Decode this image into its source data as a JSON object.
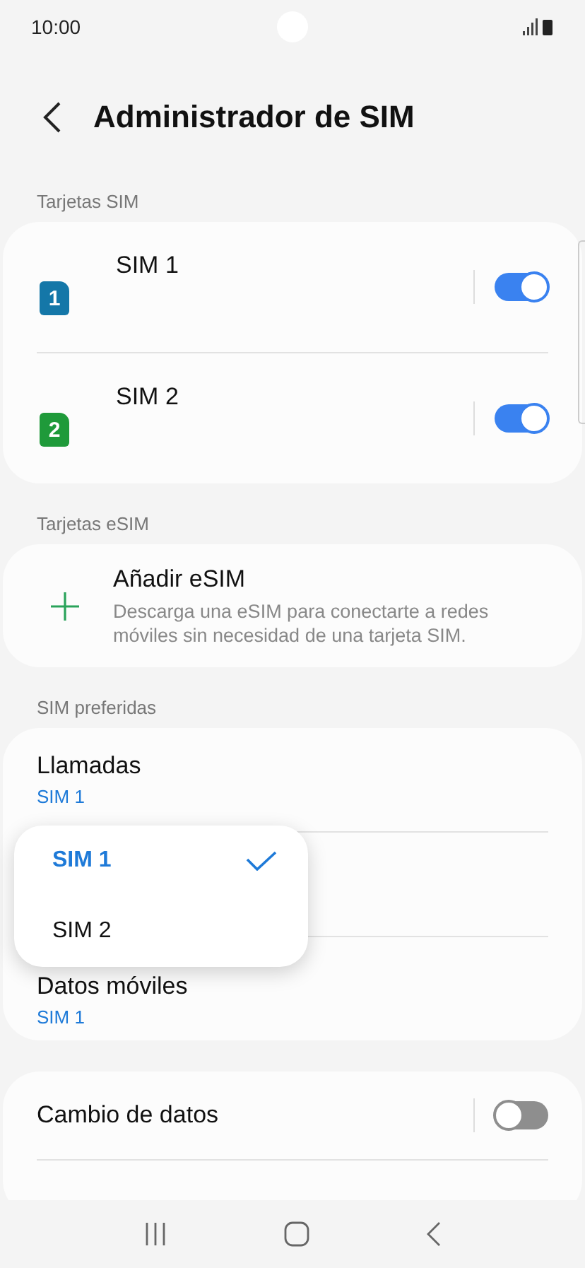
{
  "status_bar": {
    "time": "10:00"
  },
  "header": {
    "title": "Administrador de SIM"
  },
  "sim_section": {
    "label": "Tarjetas SIM",
    "cards": [
      {
        "name": "SIM 1",
        "number": "1",
        "color": "#1477a8",
        "on": true
      },
      {
        "name": "SIM 2",
        "number": "2",
        "color": "#1f9a3a",
        "on": true
      }
    ]
  },
  "esim_section": {
    "label": "Tarjetas eSIM",
    "title": "Añadir eSIM",
    "description": "Descarga una eSIM para conectarte a redes móviles sin necesidad de una tarjeta SIM."
  },
  "preferred_section": {
    "label": "SIM preferidas",
    "items": [
      {
        "title": "Llamadas",
        "value": "SIM 1"
      },
      {
        "title": "Datos móviles",
        "value": "SIM 1"
      }
    ]
  },
  "data_switch": {
    "label": "Cambio de datos",
    "on": false
  },
  "popup": {
    "options": [
      {
        "label": "SIM 1",
        "selected": true
      },
      {
        "label": "SIM 2",
        "selected": false
      }
    ]
  }
}
